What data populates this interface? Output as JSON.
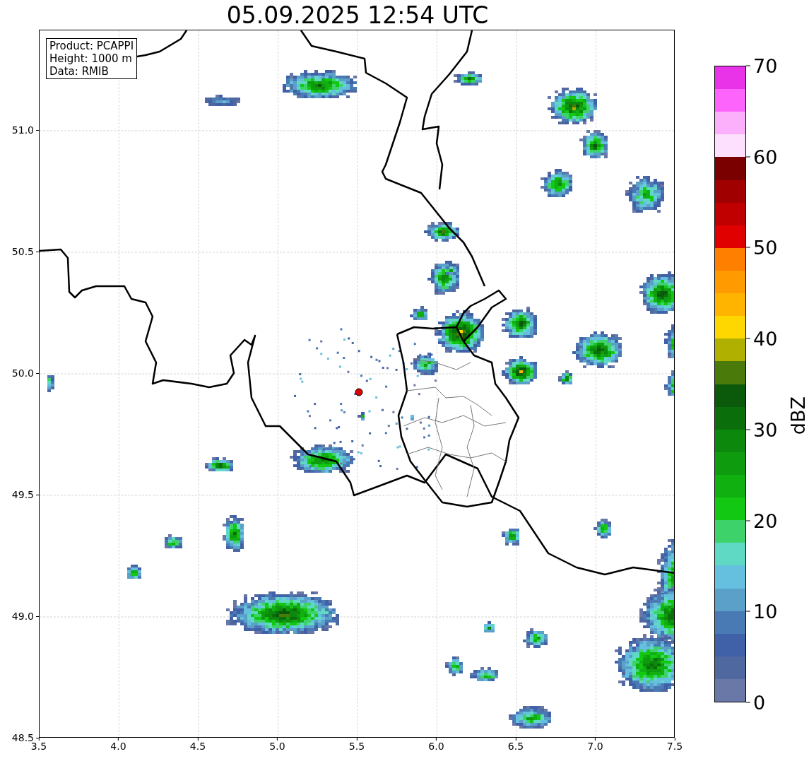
{
  "title": "05.09.2025 12:54 UTC",
  "info_box": [
    "Product: PCAPPI",
    "Height: 1000 m",
    "Data: RMIB"
  ],
  "map": {
    "xticks": [
      "3.5",
      "4.0",
      "4.5",
      "5.0",
      "5.5",
      "6.0",
      "6.5",
      "7.0",
      "7.5"
    ],
    "yticks": [
      "51.0",
      "50.5",
      "50.0",
      "49.5",
      "49.0",
      "48.5"
    ]
  },
  "colorbar": {
    "label": "dBZ",
    "ticks": [
      "70",
      "60",
      "50",
      "40",
      "30",
      "20",
      "10",
      "0"
    ],
    "levels": [
      {
        "color": "#e833e8"
      },
      {
        "color": "#fc64fc"
      },
      {
        "color": "#fcb0fc"
      },
      {
        "color": "#fde0fd"
      },
      {
        "color": "#7a0000"
      },
      {
        "color": "#a00000"
      },
      {
        "color": "#c00000"
      },
      {
        "color": "#e00000"
      },
      {
        "color": "#ff7f00"
      },
      {
        "color": "#ff9a00"
      },
      {
        "color": "#ffb400"
      },
      {
        "color": "#ffd700"
      },
      {
        "color": "#b0b000"
      },
      {
        "color": "#4a7a0a"
      },
      {
        "color": "#0b5a0b"
      },
      {
        "color": "#0a6e0a"
      },
      {
        "color": "#0c880c"
      },
      {
        "color": "#0e9c0e"
      },
      {
        "color": "#10b010"
      },
      {
        "color": "#12c812"
      },
      {
        "color": "#3dd36a"
      },
      {
        "color": "#5fd8c4"
      },
      {
        "color": "#65c0e0"
      },
      {
        "color": "#5aa0c8"
      },
      {
        "color": "#4a7ab4"
      },
      {
        "color": "#4060a8"
      },
      {
        "color": "#5068a0"
      },
      {
        "color": "#6a78a8"
      }
    ]
  }
}
